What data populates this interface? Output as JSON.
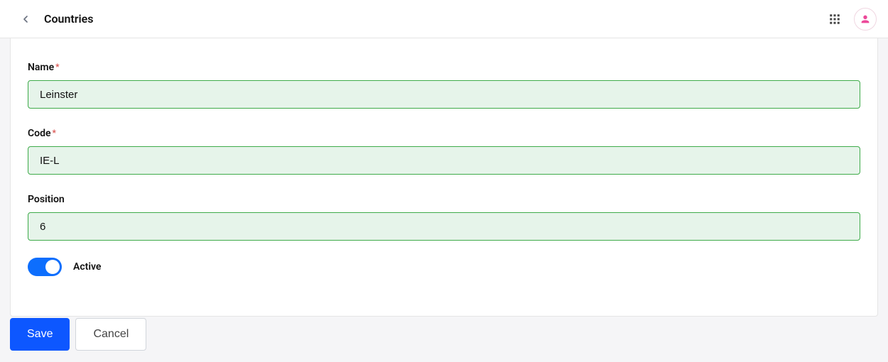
{
  "header": {
    "title": "Countries"
  },
  "form": {
    "name": {
      "label": "Name",
      "required": true,
      "value": "Leinster"
    },
    "code": {
      "label": "Code",
      "required": true,
      "value": "IE-L"
    },
    "position": {
      "label": "Position",
      "required": false,
      "value": "6"
    },
    "active": {
      "label": "Active",
      "value": true
    }
  },
  "actions": {
    "save": "Save",
    "cancel": "Cancel"
  }
}
